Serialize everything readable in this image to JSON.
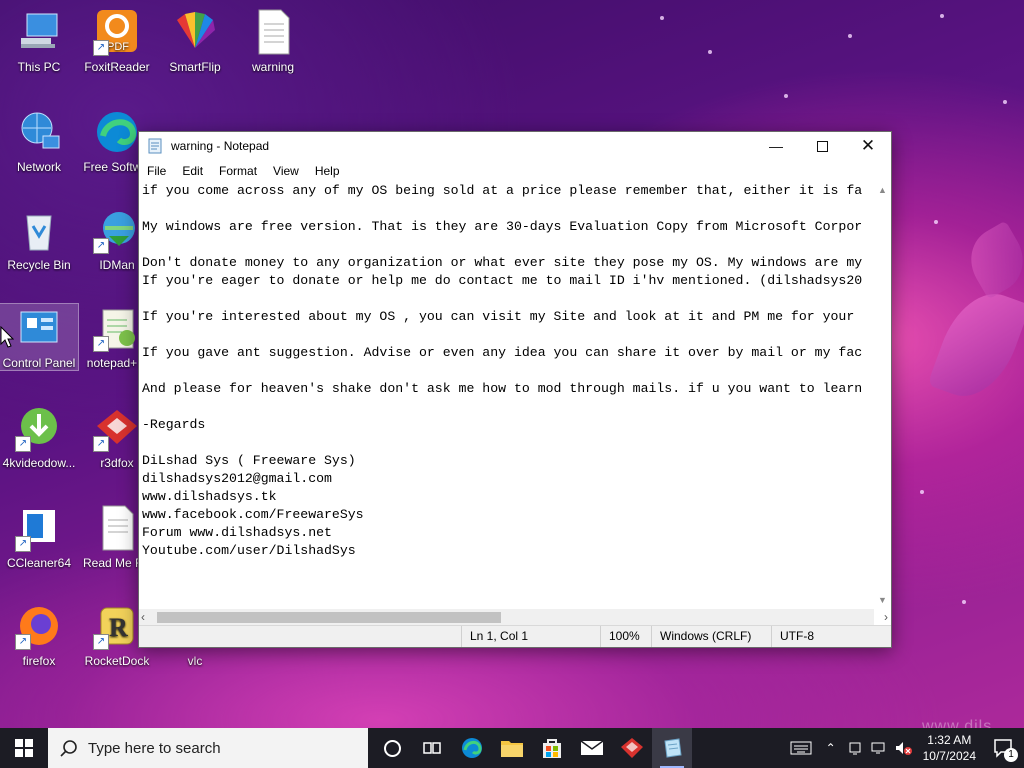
{
  "desktop": {
    "icons": [
      {
        "label": "This PC"
      },
      {
        "label": "FoxitReader"
      },
      {
        "label": "SmartFlip"
      },
      {
        "label": "warning"
      },
      {
        "label": "Network"
      },
      {
        "label": "Free Softw..."
      },
      {
        "label": "Recycle Bin"
      },
      {
        "label": "IDMan"
      },
      {
        "label": "Control Panel"
      },
      {
        "label": "notepad+..."
      },
      {
        "label": "4kvideodow..."
      },
      {
        "label": "r3dfox"
      },
      {
        "label": "CCleaner64"
      },
      {
        "label": "Read Me F..."
      },
      {
        "label": "firefox"
      },
      {
        "label": "RocketDock"
      },
      {
        "label": "vlc"
      }
    ],
    "pdf_badge": "PDF",
    "rocketdock_letter": "R"
  },
  "notepad": {
    "title": "warning - Notepad",
    "menu": [
      "File",
      "Edit",
      "Format",
      "View",
      "Help"
    ],
    "lines": [
      "if you come across any of my OS being sold at a price please remember that, either it is fa",
      "",
      "My windows are free version. That is they are 30-days Evaluation Copy from Microsoft Corpor",
      "",
      "Don't donate money to any organization or what ever site they pose my OS. My windows are my",
      "If you're eager to donate or help me do contact me to mail ID i'hv mentioned. (dilshadsys20",
      "",
      "If you're interested about my OS , you can visit my Site and look at it and PM me for your",
      "",
      "If you gave ant suggestion. Advise or even any idea you can share it over by mail or my fac",
      "",
      "And please for heaven's shake don't ask me how to mod through mails. if u you want to learn",
      "",
      "-Regards",
      "",
      "DiLshad Sys ( Freeware Sys)",
      "dilshadsys2012@gmail.com",
      "www.dilshadsys.tk",
      "www.facebook.com/FreewareSys",
      "Forum www.dilshadsys.net",
      "Youtube.com/user/DilshadSys"
    ],
    "status": {
      "position": "Ln 1, Col 1",
      "zoom": "100%",
      "line_endings": "Windows (CRLF)",
      "encoding": "UTF-8"
    }
  },
  "taskbar": {
    "search_placeholder": "Type here to search",
    "clock_time": "1:32 AM",
    "clock_date": "10/7/2024",
    "notification_count": "1"
  },
  "watermark": "www.dils"
}
